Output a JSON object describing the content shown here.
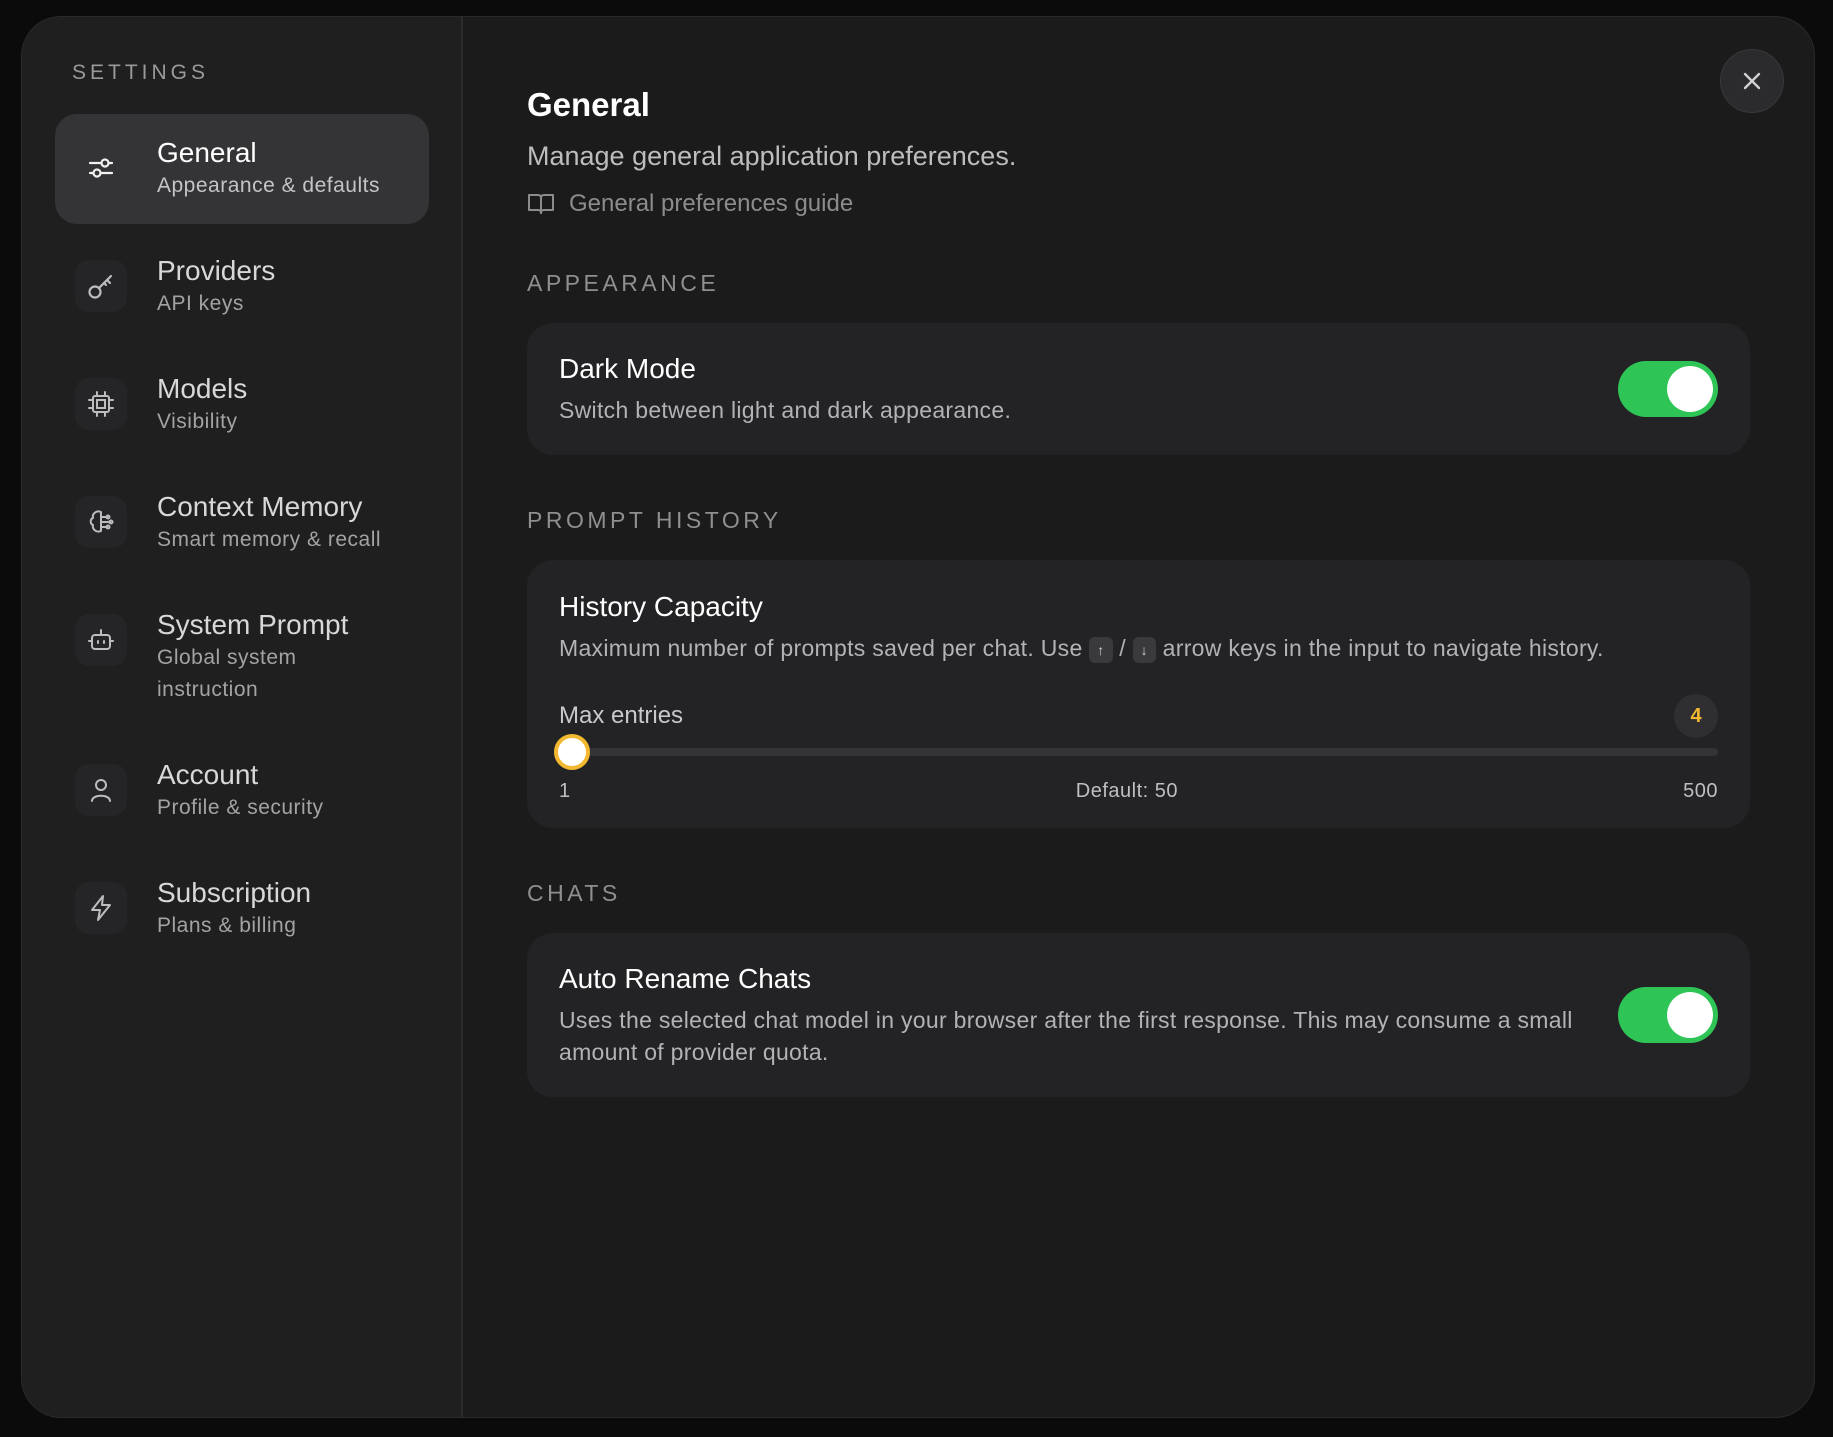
{
  "sidebar": {
    "heading": "SETTINGS",
    "items": [
      {
        "title": "General",
        "subtitle": "Appearance & defaults",
        "icon": "sliders-icon",
        "active": true
      },
      {
        "title": "Providers",
        "subtitle": "API keys",
        "icon": "key-icon",
        "active": false
      },
      {
        "title": "Models",
        "subtitle": "Visibility",
        "icon": "chip-icon",
        "active": false
      },
      {
        "title": "Context Memory",
        "subtitle": "Smart memory & recall",
        "icon": "brain-icon",
        "active": false
      },
      {
        "title": "System Prompt",
        "subtitle": "Global system instruction",
        "icon": "bot-icon",
        "active": false
      },
      {
        "title": "Account",
        "subtitle": "Profile & security",
        "icon": "user-icon",
        "active": false
      },
      {
        "title": "Subscription",
        "subtitle": "Plans & billing",
        "icon": "bolt-icon",
        "active": false
      }
    ]
  },
  "main": {
    "title": "General",
    "subtitle": "Manage general application preferences.",
    "guide_link": "General preferences guide",
    "sections": {
      "appearance": {
        "label": "APPEARANCE",
        "dark_mode": {
          "title": "Dark Mode",
          "description": "Switch between light and dark appearance.",
          "enabled": true
        }
      },
      "prompt_history": {
        "label": "PROMPT HISTORY",
        "history_capacity": {
          "title": "History Capacity",
          "description_before": "Maximum number of prompts saved per chat. Use",
          "key_up": "↑",
          "separator": "/",
          "key_down": "↓",
          "description_after": "arrow keys in the input to navigate history.",
          "slider_label": "Max entries",
          "value": 4,
          "value_text": "4",
          "min": 1,
          "max": 500,
          "min_label": "1",
          "default_label": "Default: 50",
          "max_label": "500"
        }
      },
      "chats": {
        "label": "CHATS",
        "auto_rename": {
          "title": "Auto Rename Chats",
          "description": "Uses the selected chat model in your browser after the first response. This may consume a small amount of provider quota.",
          "enabled": true
        }
      }
    }
  },
  "colors": {
    "toggle_on": "#2ec556",
    "accent": "#f1b830",
    "background": "#1b1b1c"
  }
}
